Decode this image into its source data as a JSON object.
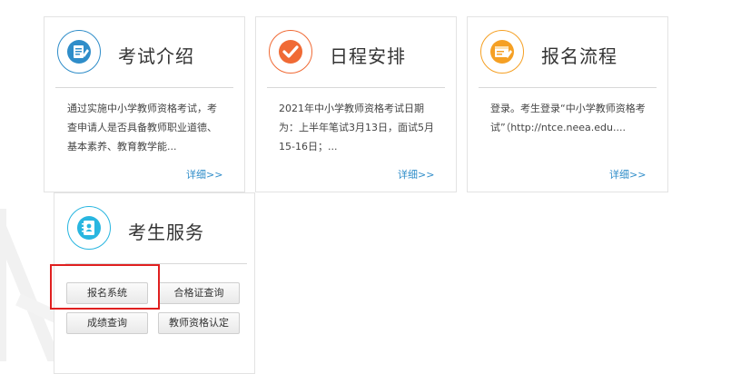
{
  "cards": [
    {
      "title": "考试介绍",
      "desc": "通过实施中小学教师资格考试，考查申请人是否具备教师职业道德、基本素养、教育教学能...",
      "more": "详细>>",
      "icon": "document-edit-icon",
      "color": "#2f8dc9"
    },
    {
      "title": "日程安排",
      "desc": "2021年中小学教师资格考试日期为：上半年笔试3月13日，面试5月15-16日；...",
      "more": "详细>>",
      "icon": "checkmark-icon",
      "color": "#f06a35"
    },
    {
      "title": "报名流程",
      "desc": "登录。考生登录“中小学教师资格考试”（http://ntce.neea.edu....",
      "more": "详细>>",
      "icon": "browser-edit-icon",
      "color": "#f5a024"
    }
  ],
  "service": {
    "title": "考生服务",
    "icon": "contacts-book-icon",
    "color": "#29b6e0",
    "buttons": [
      "报名系统",
      "合格证查询",
      "成绩查询",
      "教师资格认定"
    ]
  },
  "highlight_color": "#e02020"
}
